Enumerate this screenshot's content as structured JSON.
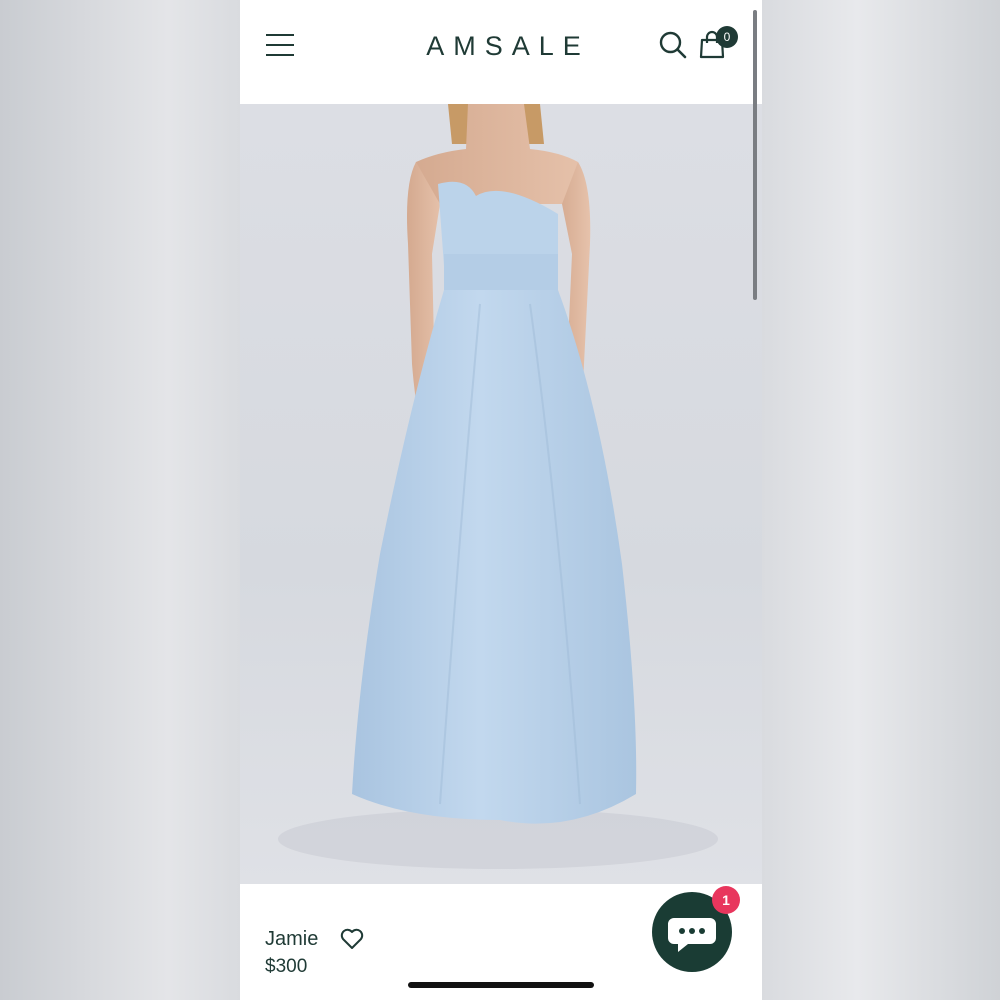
{
  "header": {
    "brand": "AMSALE",
    "cart_count": "0"
  },
  "product": {
    "name": "Jamie",
    "price": "$300",
    "dress_color": "#b9d2ea"
  },
  "chat": {
    "unread_count": "1"
  },
  "icons": [
    "hamburger-menu-icon",
    "search-icon",
    "shopping-bag-icon",
    "heart-icon",
    "chat-bubble-icon"
  ],
  "colors": {
    "brand": "#1f3a35",
    "chat_button": "#1a3c34",
    "badge": "#e8365d"
  }
}
